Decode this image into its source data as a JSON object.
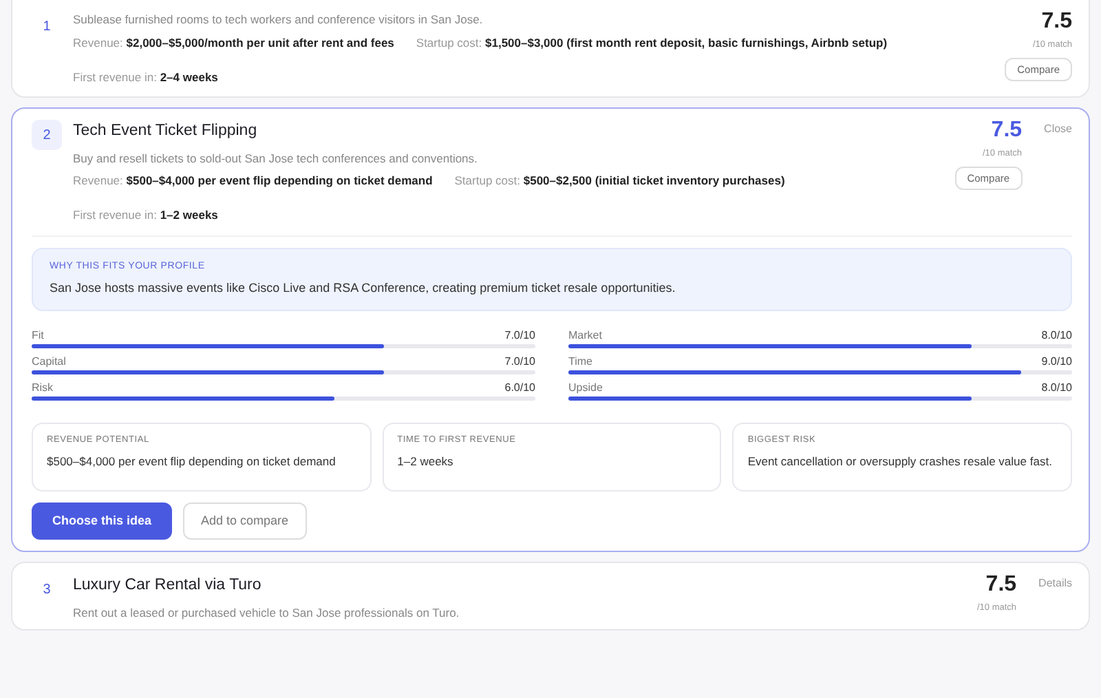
{
  "ideas": [
    {
      "rank": "1",
      "description": "Sublease furnished rooms to tech workers and conference visitors in San Jose.",
      "revenue_label": "Revenue:",
      "revenue": "$2,000–$5,000/month per unit after rent and fees",
      "startup_label": "Startup cost:",
      "startup": "$1,500–$3,000 (first month rent deposit, basic furnishings, Airbnb setup)",
      "first_label": "First revenue in:",
      "first": "2–4 weeks",
      "score": "7.5",
      "score_suffix": "/10 match",
      "compare": "Compare",
      "expanded": false
    },
    {
      "rank": "2",
      "title": "Tech Event Ticket Flipping",
      "description": "Buy and resell tickets to sold-out San Jose tech conferences and conventions.",
      "revenue_label": "Revenue:",
      "revenue": "$500–$4,000 per event flip depending on ticket demand",
      "startup_label": "Startup cost:",
      "startup": "$500–$2,500 (initial ticket inventory purchases)",
      "first_label": "First revenue in:",
      "first": "1–2 weeks",
      "score": "7.5",
      "score_suffix": "/10 match",
      "compare": "Compare",
      "action": "Close",
      "expanded": true,
      "details": {
        "why_heading": "WHY THIS FITS YOUR PROFILE",
        "why_text": "San Jose hosts massive events like Cisco Live and RSA Conference, creating premium ticket resale opportunities.",
        "metrics": [
          {
            "label": "Fit",
            "reading": "7.0/10",
            "level": 0.7
          },
          {
            "label": "Market",
            "reading": "8.0/10",
            "level": 0.8
          },
          {
            "label": "Capital",
            "reading": "7.0/10",
            "level": 0.7
          },
          {
            "label": "Time",
            "reading": "9.0/10",
            "level": 0.9
          },
          {
            "label": "Risk",
            "reading": "6.0/10",
            "level": 0.6
          },
          {
            "label": "Upside",
            "reading": "8.0/10",
            "level": 0.8
          }
        ],
        "facts": [
          {
            "heading": "REVENUE POTENTIAL",
            "text": "$500–$4,000 per event flip depending on ticket demand"
          },
          {
            "heading": "TIME TO FIRST REVENUE",
            "text": "1–2 weeks"
          },
          {
            "heading": "BIGGEST RISK",
            "text": "Event cancellation or oversupply crashes resale value fast."
          }
        ],
        "primary_button": "Choose this idea",
        "secondary_button": "Add to compare"
      }
    },
    {
      "rank": "3",
      "title": "Luxury Car Rental via Turo",
      "description": "Rent out a leased or purchased vehicle to San Jose professionals on Turo.",
      "score": "7.5",
      "score_suffix": "/10 match",
      "action": "Details",
      "expanded": false
    }
  ]
}
